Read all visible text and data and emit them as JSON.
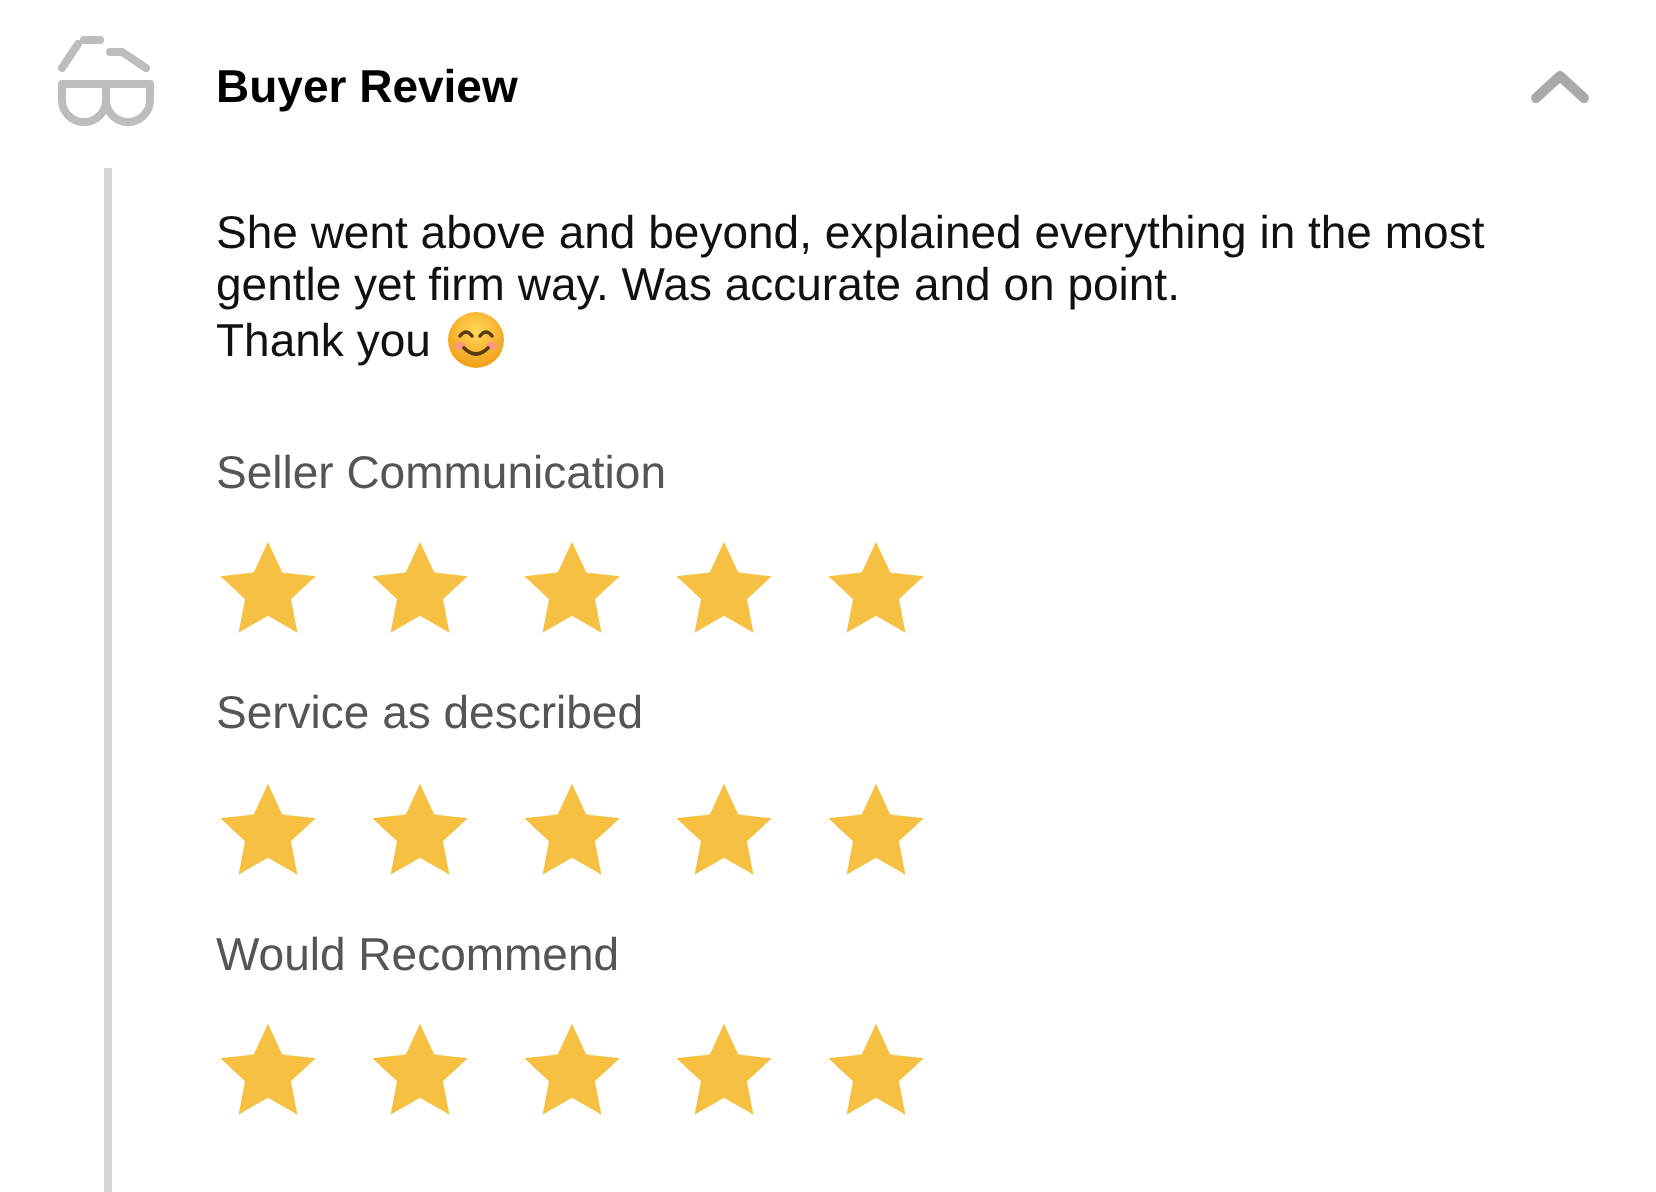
{
  "review": {
    "title": "Buyer Review",
    "expanded": true,
    "text": "She went above and beyond, explained everything in the most gentle yet firm way. Was accurate and on point.",
    "closing": "Thank you",
    "ratings": [
      {
        "label": "Seller Communication",
        "stars": 5
      },
      {
        "label": "Service as described",
        "stars": 5
      },
      {
        "label": "Would Recommend",
        "stars": 5
      }
    ]
  }
}
